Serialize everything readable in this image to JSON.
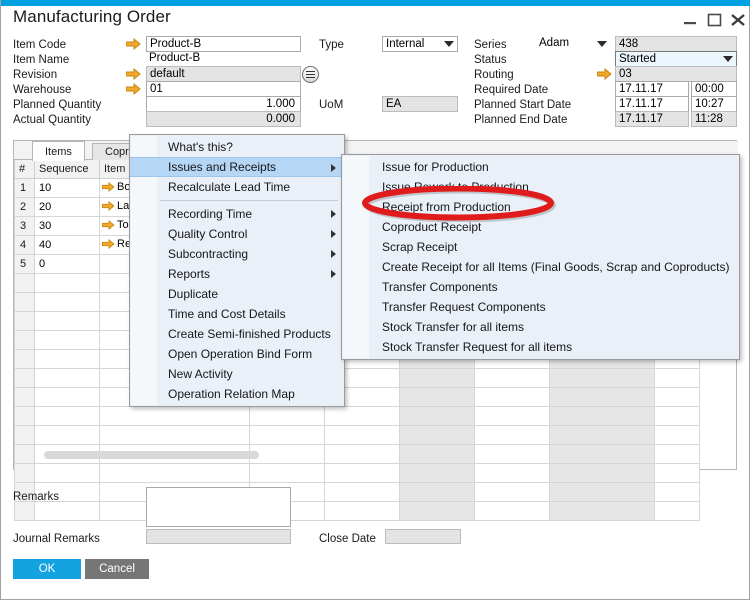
{
  "window": {
    "title": "Manufacturing Order",
    "accent_color": "#00a0e1",
    "controls": [
      {
        "name": "minimize",
        "glyph": "minimize-icon"
      },
      {
        "name": "maximize",
        "glyph": "maximize-icon"
      },
      {
        "name": "close",
        "glyph": "close-icon"
      }
    ]
  },
  "header": {
    "left": {
      "item_code_label": "Item Code",
      "item_code_value": "Product-B",
      "item_name_label": "Item Name",
      "item_name_value": "Product-B",
      "revision_label": "Revision",
      "revision_value": "default",
      "warehouse_label": "Warehouse",
      "warehouse_value": "01",
      "planned_quantity_label": "Planned Quantity",
      "planned_quantity_value": "1.000",
      "actual_quantity_label": "Actual Quantity",
      "actual_quantity_value": "0.000"
    },
    "middle": {
      "type_label": "Type",
      "type_value": "Internal",
      "uom_label": "UoM",
      "uom_value": "EA"
    },
    "right": {
      "series_label": "Series",
      "series_value": "Adam",
      "doc_number_value": "438",
      "status_label": "Status",
      "status_value": "Started",
      "routing_label": "Routing",
      "routing_value": "03",
      "required_date_label": "Required Date",
      "required_date_value": "17.11.17",
      "required_time_value": "00:00",
      "planned_start_date_label": "Planned Start Date",
      "planned_start_date_value": "17.11.17",
      "planned_start_time_value": "10:27",
      "planned_end_date_label": "Planned End Date",
      "planned_end_date_value": "17.11.17",
      "planned_end_time_value": "11:28"
    }
  },
  "grid": {
    "tabs": [
      {
        "label": "Items",
        "active": true
      },
      {
        "label": "Coproducts",
        "active": false
      }
    ],
    "columns": [
      "#",
      "Sequence",
      "Item Code"
    ],
    "rows": [
      {
        "num": "1",
        "sequence": "10",
        "item_code": "Bot",
        "has_indicator": true
      },
      {
        "num": "2",
        "sequence": "20",
        "item_code": "Lab",
        "has_indicator": true
      },
      {
        "num": "3",
        "sequence": "30",
        "item_code": "Top",
        "has_indicator": true
      },
      {
        "num": "4",
        "sequence": "40",
        "item_code": "Rec",
        "has_indicator": true
      },
      {
        "num": "5",
        "sequence": "0",
        "item_code": "",
        "has_indicator": false
      }
    ],
    "empty_row_count": 13
  },
  "footer": {
    "remarks_label": "Remarks",
    "remarks_value": "",
    "journal_remarks_label": "Journal Remarks",
    "journal_remarks_value": "",
    "close_date_label": "Close Date",
    "close_date_value": "",
    "ok_label": "OK",
    "cancel_label": "Cancel",
    "ok_color": "#13a3e0",
    "cancel_color": "#767676"
  },
  "context_menu": {
    "items": [
      {
        "label": "What's this?",
        "submenu": false,
        "highlighted": false,
        "separator_after": false
      },
      {
        "label": "Issues and Receipts",
        "submenu": true,
        "highlighted": true,
        "separator_after": false
      },
      {
        "label": "Recalculate Lead Time",
        "submenu": false,
        "highlighted": false,
        "separator_after": true
      },
      {
        "label": "Recording Time",
        "submenu": true,
        "highlighted": false,
        "separator_after": false
      },
      {
        "label": "Quality Control",
        "submenu": true,
        "highlighted": false,
        "separator_after": false
      },
      {
        "label": "Subcontracting",
        "submenu": true,
        "highlighted": false,
        "separator_after": false
      },
      {
        "label": "Reports",
        "submenu": true,
        "highlighted": false,
        "separator_after": false
      },
      {
        "label": "Duplicate",
        "submenu": false,
        "highlighted": false,
        "separator_after": false
      },
      {
        "label": "Time and Cost Details",
        "submenu": false,
        "highlighted": false,
        "separator_after": false
      },
      {
        "label": "Create Semi-finished Products",
        "submenu": false,
        "highlighted": false,
        "separator_after": false
      },
      {
        "label": "Open Operation Bind Form",
        "submenu": false,
        "highlighted": false,
        "separator_after": false
      },
      {
        "label": "New Activity",
        "submenu": false,
        "highlighted": false,
        "separator_after": false
      },
      {
        "label": "Operation Relation Map",
        "submenu": false,
        "highlighted": false,
        "separator_after": false
      }
    ]
  },
  "submenu": {
    "items": [
      {
        "label": "Issue for Production"
      },
      {
        "label": "Issue Rework to Production"
      },
      {
        "label": "Receipt from Production"
      },
      {
        "label": "Coproduct Receipt"
      },
      {
        "label": "Scrap Receipt"
      },
      {
        "label": "Create Receipt for all Items (Final Goods, Scrap and Coproducts)"
      },
      {
        "label": "Transfer Components"
      },
      {
        "label": "Transfer Request Components"
      },
      {
        "label": "Stock Transfer for all items"
      },
      {
        "label": "Stock Transfer Request for all items"
      }
    ]
  },
  "annotation": {
    "type": "ellipse-highlight",
    "target_label": "Receipt from Production",
    "color": "#e01b1b"
  }
}
